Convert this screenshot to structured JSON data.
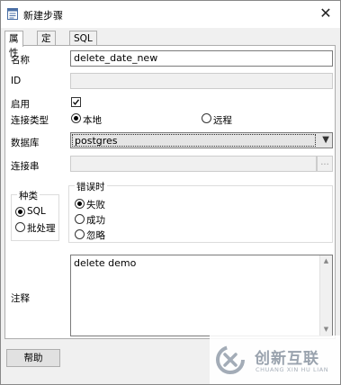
{
  "window": {
    "title": "新建步骤",
    "close_icon": "close-icon"
  },
  "tabs": [
    {
      "label": "属性",
      "active": true
    },
    {
      "label": "定义",
      "active": false
    },
    {
      "label": "SQL",
      "active": false
    }
  ],
  "form": {
    "name_label": "名称",
    "name_value": "delete_date_new",
    "id_label": "ID",
    "id_value": "",
    "enabled_label": "启用",
    "enabled_checked": true,
    "conn_type_label": "连接类型",
    "conn_local": "本地",
    "conn_remote": "远程",
    "conn_selected": "本地",
    "database_label": "数据库",
    "database_value": "postgres",
    "conn_string_label": "连接串",
    "conn_string_value": "",
    "conn_string_button": "..."
  },
  "kind_group": {
    "legend": "种类",
    "options": [
      "SQL",
      "批处理"
    ],
    "selected": "SQL"
  },
  "on_error_group": {
    "legend": "错误时",
    "options": [
      "失败",
      "成功",
      "忽略"
    ],
    "selected": "失败"
  },
  "comment": {
    "label": "注释",
    "value": "delete demo"
  },
  "footer": {
    "help_label": "帮助"
  },
  "watermark": {
    "text": "创新互联",
    "sub": "CHUANG XIN HU LIAN"
  }
}
